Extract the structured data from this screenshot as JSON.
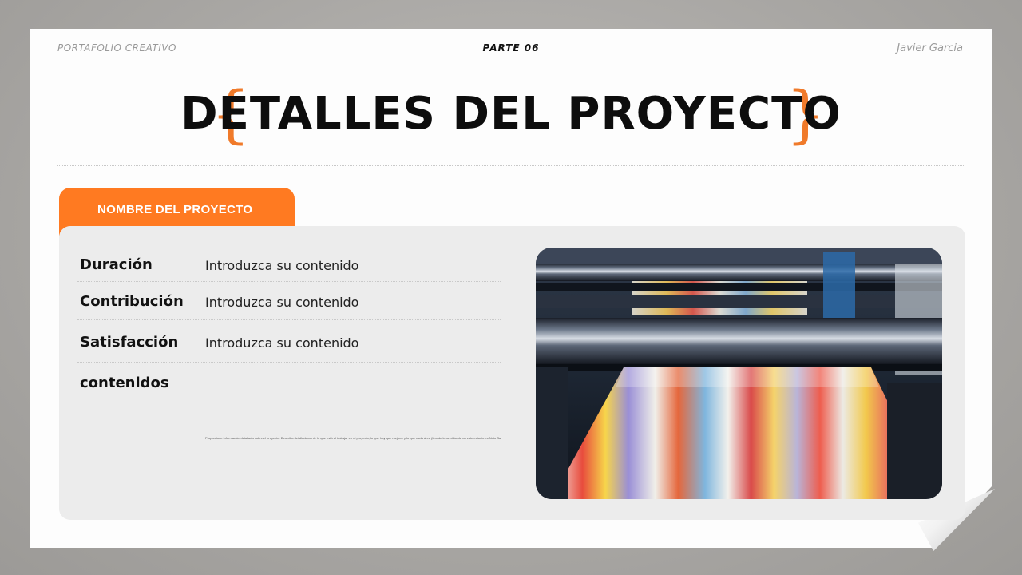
{
  "header": {
    "left_label": "PORTAFOLIO CREATIVO",
    "center_label": "PARTE 06",
    "right_label": "Javier Garcia"
  },
  "title": "DETALLES DEL PROYECTO",
  "tab_label": "NOMBRE DEL PROYECTO",
  "details": [
    {
      "label": "Duración",
      "value": "Introduzca su contenido"
    },
    {
      "label": "Contribución",
      "value": "Introduzca su contenido"
    },
    {
      "label": "Satisfacción",
      "value": "Introduzca su contenido"
    },
    {
      "label": "contenidos",
      "value": ""
    }
  ],
  "description": "Proporcione información detallada sobre el proyecto. Describa detalladamente lo que está al trabajar en el proyecto, lo que hay que mejorar y lo que cada área (tipo de letra utilizada en este estudio es Noto Sans CJK SC Demi-light)",
  "colors": {
    "accent": "#ff7a21",
    "brace": "#f07a2a",
    "panel": "#ececec"
  },
  "photo": {
    "subject": "printing-press-rollers-image"
  }
}
